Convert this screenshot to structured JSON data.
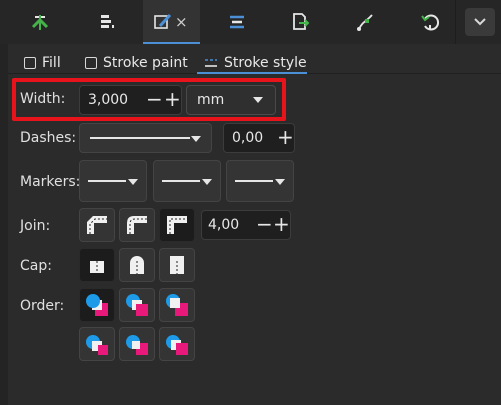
{
  "toolbar": {
    "icons": [
      "align-icon",
      "layers-icon",
      "fill-stroke-icon",
      "text-icon",
      "export-icon",
      "paths-icon",
      "undo-history-icon"
    ],
    "close_glyph": "×",
    "more_glyph": "⌄"
  },
  "tabs": [
    {
      "label": "Fill",
      "selected": false
    },
    {
      "label": "Stroke paint",
      "selected": false
    },
    {
      "label": "Stroke style",
      "selected": true
    }
  ],
  "width": {
    "label": "Width:",
    "value": "3,000",
    "unit": "mm"
  },
  "dashes": {
    "label": "Dashes:",
    "offset": "0,00"
  },
  "markers": {
    "label": "Markers:"
  },
  "join": {
    "label": "Join:",
    "miter_limit": "4,00",
    "options": [
      "bevel-join",
      "round-join",
      "miter-join"
    ],
    "selected": 2
  },
  "cap": {
    "label": "Cap:",
    "options": [
      "butt-cap",
      "round-cap",
      "square-cap"
    ],
    "selected": 0
  },
  "order": {
    "label": "Order:"
  },
  "colors": {
    "accent": "#4b8fd6",
    "highlight": "#e8141c",
    "blue": "#1e9be8",
    "pink": "#e8197a"
  }
}
